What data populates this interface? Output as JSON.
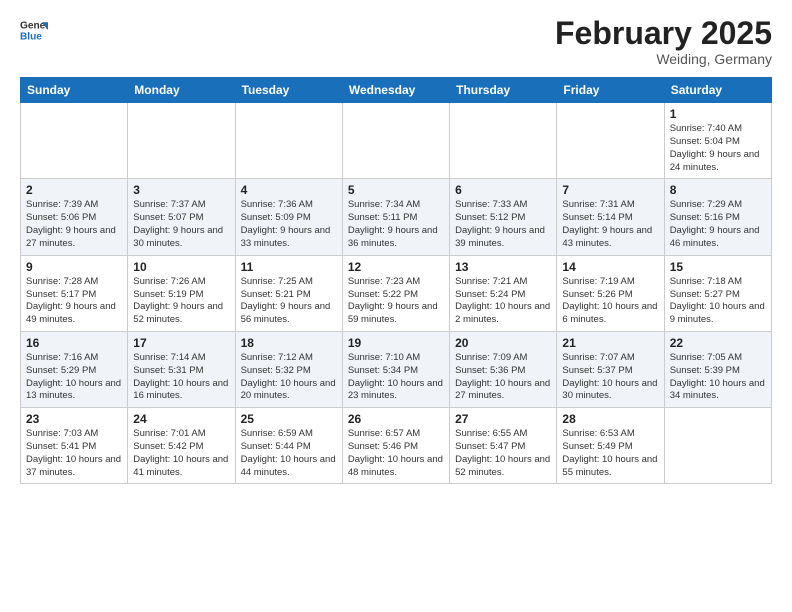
{
  "header": {
    "logo_general": "General",
    "logo_blue": "Blue",
    "cal_title": "February 2025",
    "cal_subtitle": "Weiding, Germany"
  },
  "weekdays": [
    "Sunday",
    "Monday",
    "Tuesday",
    "Wednesday",
    "Thursday",
    "Friday",
    "Saturday"
  ],
  "weeks": [
    [
      {
        "day": "",
        "info": ""
      },
      {
        "day": "",
        "info": ""
      },
      {
        "day": "",
        "info": ""
      },
      {
        "day": "",
        "info": ""
      },
      {
        "day": "",
        "info": ""
      },
      {
        "day": "",
        "info": ""
      },
      {
        "day": "1",
        "info": "Sunrise: 7:40 AM\nSunset: 5:04 PM\nDaylight: 9 hours and 24 minutes."
      }
    ],
    [
      {
        "day": "2",
        "info": "Sunrise: 7:39 AM\nSunset: 5:06 PM\nDaylight: 9 hours and 27 minutes."
      },
      {
        "day": "3",
        "info": "Sunrise: 7:37 AM\nSunset: 5:07 PM\nDaylight: 9 hours and 30 minutes."
      },
      {
        "day": "4",
        "info": "Sunrise: 7:36 AM\nSunset: 5:09 PM\nDaylight: 9 hours and 33 minutes."
      },
      {
        "day": "5",
        "info": "Sunrise: 7:34 AM\nSunset: 5:11 PM\nDaylight: 9 hours and 36 minutes."
      },
      {
        "day": "6",
        "info": "Sunrise: 7:33 AM\nSunset: 5:12 PM\nDaylight: 9 hours and 39 minutes."
      },
      {
        "day": "7",
        "info": "Sunrise: 7:31 AM\nSunset: 5:14 PM\nDaylight: 9 hours and 43 minutes."
      },
      {
        "day": "8",
        "info": "Sunrise: 7:29 AM\nSunset: 5:16 PM\nDaylight: 9 hours and 46 minutes."
      }
    ],
    [
      {
        "day": "9",
        "info": "Sunrise: 7:28 AM\nSunset: 5:17 PM\nDaylight: 9 hours and 49 minutes."
      },
      {
        "day": "10",
        "info": "Sunrise: 7:26 AM\nSunset: 5:19 PM\nDaylight: 9 hours and 52 minutes."
      },
      {
        "day": "11",
        "info": "Sunrise: 7:25 AM\nSunset: 5:21 PM\nDaylight: 9 hours and 56 minutes."
      },
      {
        "day": "12",
        "info": "Sunrise: 7:23 AM\nSunset: 5:22 PM\nDaylight: 9 hours and 59 minutes."
      },
      {
        "day": "13",
        "info": "Sunrise: 7:21 AM\nSunset: 5:24 PM\nDaylight: 10 hours and 2 minutes."
      },
      {
        "day": "14",
        "info": "Sunrise: 7:19 AM\nSunset: 5:26 PM\nDaylight: 10 hours and 6 minutes."
      },
      {
        "day": "15",
        "info": "Sunrise: 7:18 AM\nSunset: 5:27 PM\nDaylight: 10 hours and 9 minutes."
      }
    ],
    [
      {
        "day": "16",
        "info": "Sunrise: 7:16 AM\nSunset: 5:29 PM\nDaylight: 10 hours and 13 minutes."
      },
      {
        "day": "17",
        "info": "Sunrise: 7:14 AM\nSunset: 5:31 PM\nDaylight: 10 hours and 16 minutes."
      },
      {
        "day": "18",
        "info": "Sunrise: 7:12 AM\nSunset: 5:32 PM\nDaylight: 10 hours and 20 minutes."
      },
      {
        "day": "19",
        "info": "Sunrise: 7:10 AM\nSunset: 5:34 PM\nDaylight: 10 hours and 23 minutes."
      },
      {
        "day": "20",
        "info": "Sunrise: 7:09 AM\nSunset: 5:36 PM\nDaylight: 10 hours and 27 minutes."
      },
      {
        "day": "21",
        "info": "Sunrise: 7:07 AM\nSunset: 5:37 PM\nDaylight: 10 hours and 30 minutes."
      },
      {
        "day": "22",
        "info": "Sunrise: 7:05 AM\nSunset: 5:39 PM\nDaylight: 10 hours and 34 minutes."
      }
    ],
    [
      {
        "day": "23",
        "info": "Sunrise: 7:03 AM\nSunset: 5:41 PM\nDaylight: 10 hours and 37 minutes."
      },
      {
        "day": "24",
        "info": "Sunrise: 7:01 AM\nSunset: 5:42 PM\nDaylight: 10 hours and 41 minutes."
      },
      {
        "day": "25",
        "info": "Sunrise: 6:59 AM\nSunset: 5:44 PM\nDaylight: 10 hours and 44 minutes."
      },
      {
        "day": "26",
        "info": "Sunrise: 6:57 AM\nSunset: 5:46 PM\nDaylight: 10 hours and 48 minutes."
      },
      {
        "day": "27",
        "info": "Sunrise: 6:55 AM\nSunset: 5:47 PM\nDaylight: 10 hours and 52 minutes."
      },
      {
        "day": "28",
        "info": "Sunrise: 6:53 AM\nSunset: 5:49 PM\nDaylight: 10 hours and 55 minutes."
      },
      {
        "day": "",
        "info": ""
      }
    ]
  ]
}
